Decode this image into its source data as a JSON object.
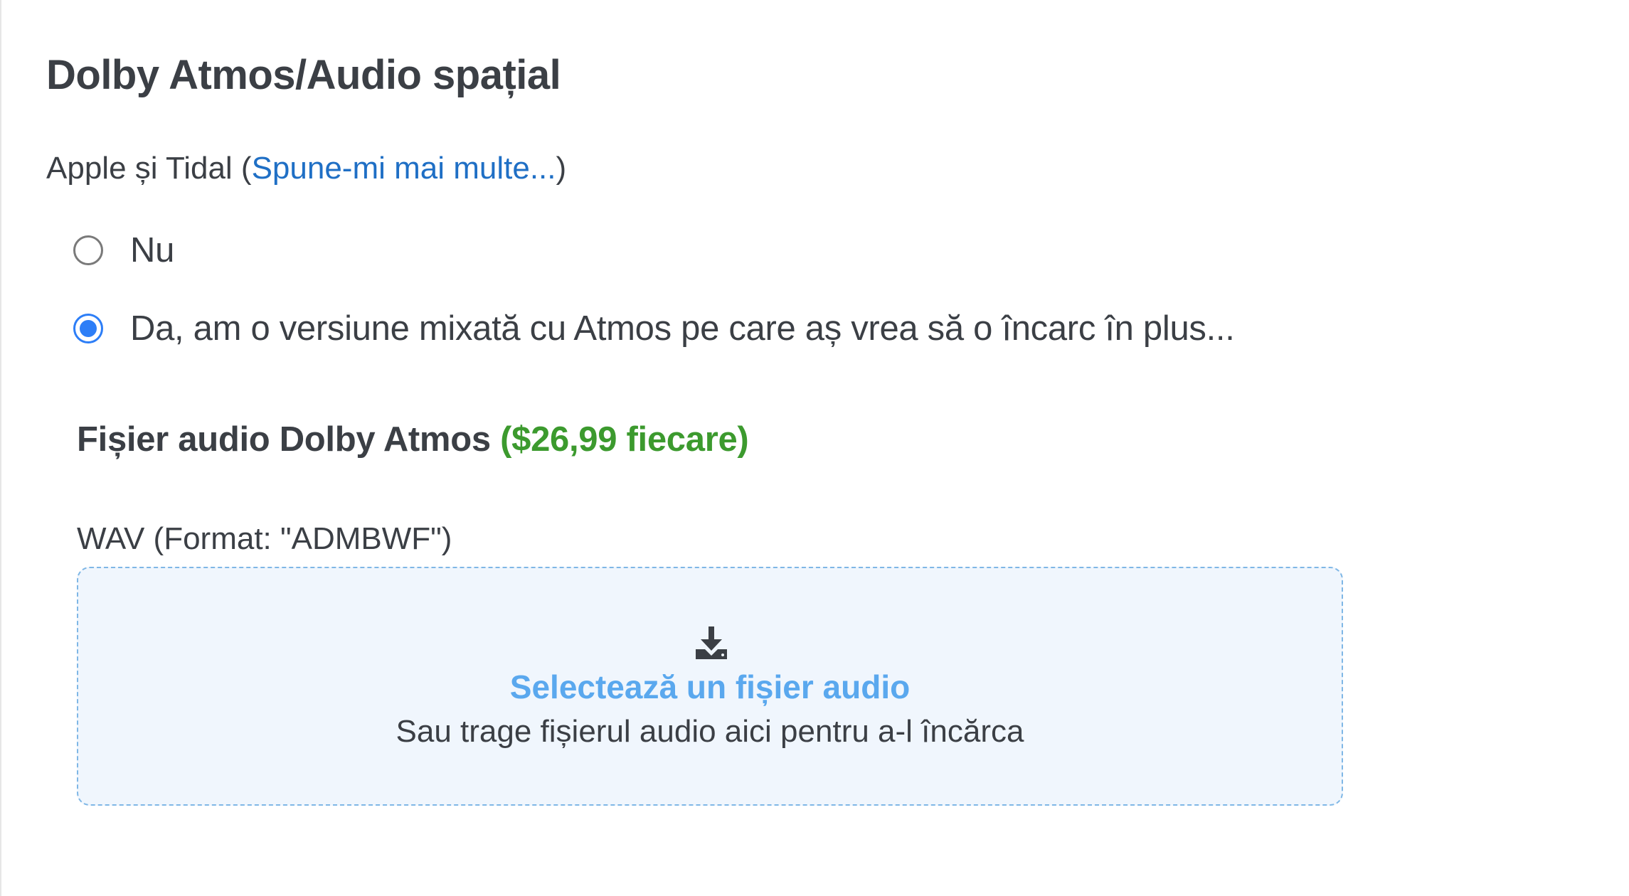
{
  "section": {
    "title": "Dolby Atmos/Audio spațial"
  },
  "subtitle": {
    "prefix": "Apple și Tidal (",
    "link": "Spune-mi mai multe...",
    "suffix": ")"
  },
  "options": [
    {
      "label": "Nu",
      "selected": false
    },
    {
      "label": "Da, am o versiune mixată cu Atmos pe care aș vrea să o încarc în plus...",
      "selected": true
    }
  ],
  "file": {
    "heading": "Fișier audio Dolby Atmos",
    "price": "($26,99 fiecare)",
    "format_label": "WAV (Format: \"ADMBWF\")"
  },
  "dropzone": {
    "icon": "download-icon",
    "select_label": "Selectează un fișier audio",
    "hint": "Sau trage fișierul audio aici pentru a-l încărca"
  },
  "colors": {
    "link": "#1f6fc5",
    "price": "#3c9a2e",
    "radio_selected": "#2d7ef7",
    "dropzone_bg": "#f0f6fd",
    "dropzone_border": "#7fb7e6",
    "select_label": "#5aa8ee"
  }
}
